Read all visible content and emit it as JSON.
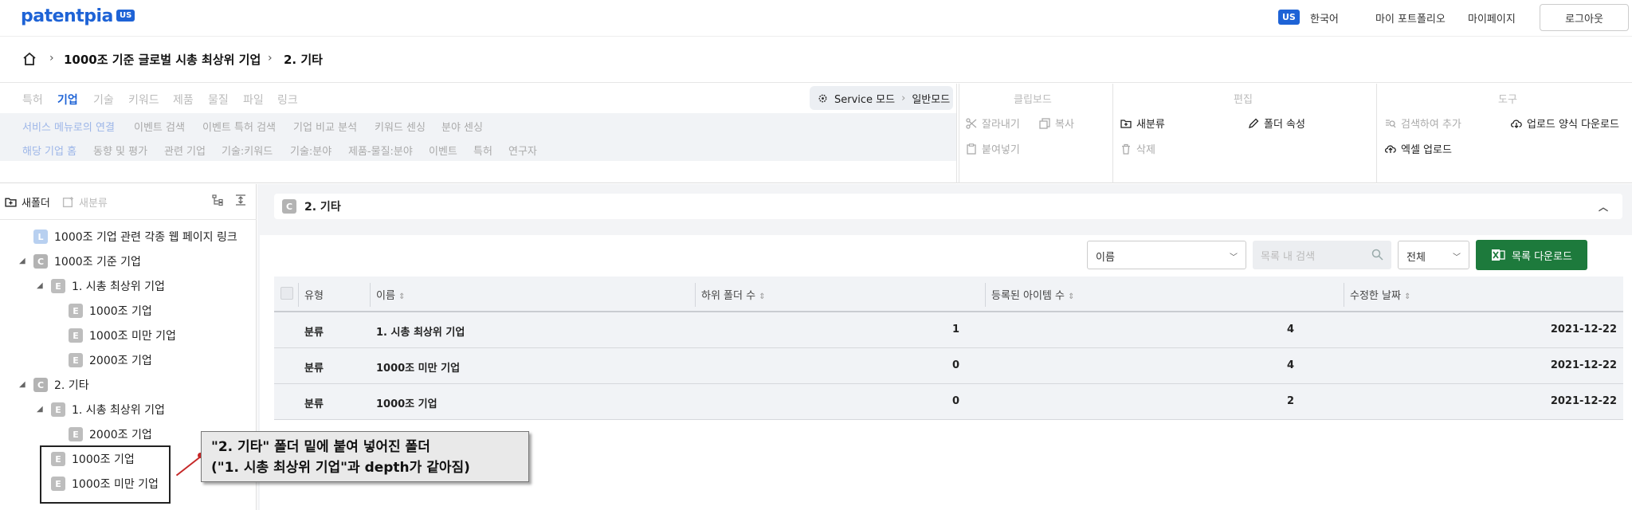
{
  "header": {
    "logo": "patentpia",
    "logo_badge": "US",
    "lang_badge": "US",
    "language": "한국어",
    "my_portfolio": "마이 포트폴리오",
    "my_page": "마이페이지",
    "logout": "로그아웃"
  },
  "breadcrumb": {
    "items": [
      "1000조 기준 글로벌 시총 최상위 기업",
      "2. 기타"
    ]
  },
  "toolbar": {
    "tabs": [
      "특허",
      "기업",
      "기술",
      "키워드",
      "제품",
      "물질",
      "파일",
      "링크"
    ],
    "active_tab": "기업",
    "service_mode": "Service 모드",
    "mode": "일반모드",
    "row2": [
      "서비스 메뉴로의 연결",
      "이벤트 검색",
      "이벤트 특허 검색",
      "기업 비교 분석",
      "키워드 센싱",
      "분야 센싱"
    ],
    "row3": [
      "해당 기업 홈",
      "동향 및 평가",
      "관련 기업",
      "기술:키워드",
      "기술:분야",
      "제품-물질:분야",
      "이벤트",
      "특허",
      "연구자"
    ],
    "clipboard": {
      "title": "클립보드",
      "cut": "잘라내기",
      "copy": "복사",
      "paste": "붙여넣기"
    },
    "edit": {
      "title": "편집",
      "reclassify": "새분류",
      "folder_props": "폴더 속성",
      "delete": "삭제"
    },
    "tools": {
      "title": "도구",
      "search_add": "검색하여 추가",
      "upload_form_download": "업로드 양식 다운로드",
      "excel_upload": "엑셀 업로드"
    }
  },
  "tree": {
    "new_folder": "새폴더",
    "new_class": "새분류",
    "nodes": [
      {
        "badge": "L",
        "label": "1000조 기업 관련 각종 웹 페이지 링크"
      },
      {
        "badge": "C",
        "label": "1000조 기준 기업"
      },
      {
        "badge": "E",
        "label": "1. 시총 최상위 기업"
      },
      {
        "badge": "E",
        "label": "1000조 기업"
      },
      {
        "badge": "E",
        "label": "1000조 미만 기업"
      },
      {
        "badge": "E",
        "label": "2000조 기업"
      },
      {
        "badge": "C",
        "label": "2. 기타"
      },
      {
        "badge": "E",
        "label": "1. 시총 최상위 기업"
      },
      {
        "badge": "E",
        "label": "2000조 기업"
      },
      {
        "badge": "E",
        "label": "1000조 기업"
      },
      {
        "badge": "E",
        "label": "1000조 미만 기업"
      }
    ]
  },
  "callout": {
    "line1": "\"2. 기타\" 폴더 밑에 붙여 넣어진 폴더",
    "line2": "(\"1. 시총 최상위 기업\"과 depth가 같아짐)"
  },
  "main": {
    "folder_badge": "C",
    "folder_title": "2. 기타",
    "sort_select": "이름",
    "search_placeholder": "목록 내 검색",
    "filter_select": "전체",
    "download_button": "목록 다운로드",
    "columns": [
      "유형",
      "이름",
      "하위 폴더 수",
      "등록된 아이템 수",
      "수정한 날짜"
    ],
    "rows": [
      {
        "type": "분류",
        "name": "1. 시총 최상위 기업",
        "subfolders": "1",
        "items": "4",
        "modified": "2021-12-22"
      },
      {
        "type": "분류",
        "name": "1000조 미만 기업",
        "subfolders": "0",
        "items": "4",
        "modified": "2021-12-22"
      },
      {
        "type": "분류",
        "name": "1000조 기업",
        "subfolders": "0",
        "items": "2",
        "modified": "2021-12-22"
      }
    ]
  },
  "colors": {
    "brand": "#1e63d6",
    "excel_green": "#1d7a3c",
    "callout_pin": "#c62828"
  }
}
